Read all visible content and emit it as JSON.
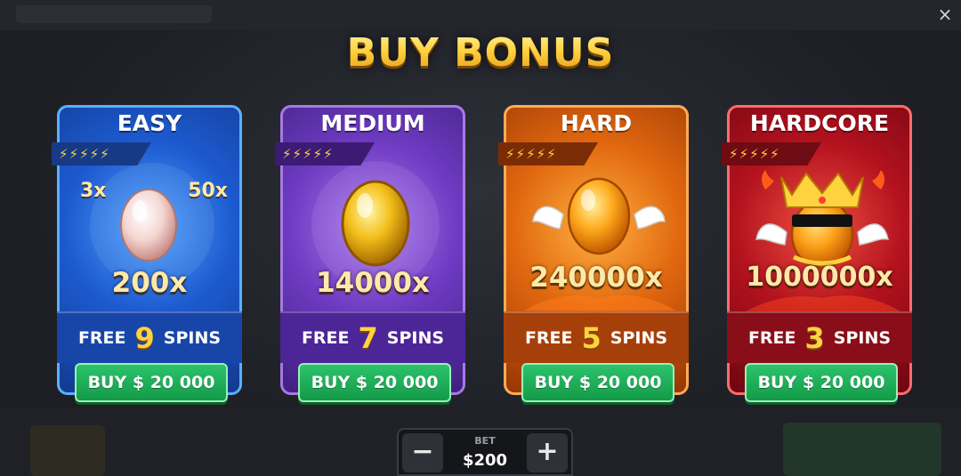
{
  "title": "BUY BONUS",
  "close_glyph": "×",
  "cards": [
    {
      "name": "EASY",
      "bolts": "⚡⚡⚡⚡⚡",
      "left_mult": "3x",
      "right_mult": "50x",
      "multiplier": "200x",
      "free_label": "FREE",
      "spins": "9",
      "spins_label": "SPINS",
      "buy_label": "BUY $ 20 000",
      "icon": "pink-egg-icon",
      "color": "#1d5ad0"
    },
    {
      "name": "MEDIUM",
      "bolts": "⚡⚡⚡⚡⚡",
      "multiplier": "14000x",
      "free_label": "FREE",
      "spins": "7",
      "spins_label": "SPINS",
      "buy_label": "BUY $ 20 000",
      "icon": "golden-egg-icon",
      "color": "#6e3bc2"
    },
    {
      "name": "HARD",
      "bolts": "⚡⚡⚡⚡⚡",
      "multiplier": "240000x",
      "free_label": "FREE",
      "spins": "5",
      "spins_label": "SPINS",
      "buy_label": "BUY $ 20 000",
      "icon": "winged-egg-icon",
      "color": "#e0670f"
    },
    {
      "name": "HARDCORE",
      "bolts": "⚡⚡⚡⚡⚡",
      "multiplier": "1000000x",
      "free_label": "FREE",
      "spins": "3",
      "spins_label": "SPINS",
      "buy_label": "BUY $ 20 000",
      "icon": "crowned-egg-icon",
      "color": "#b3121e"
    }
  ],
  "bet": {
    "label": "BET",
    "value": "$200",
    "minus": "−",
    "plus": "+"
  },
  "colors": {
    "title_gold": "#ffd23f",
    "buy_green": "#139a48"
  }
}
